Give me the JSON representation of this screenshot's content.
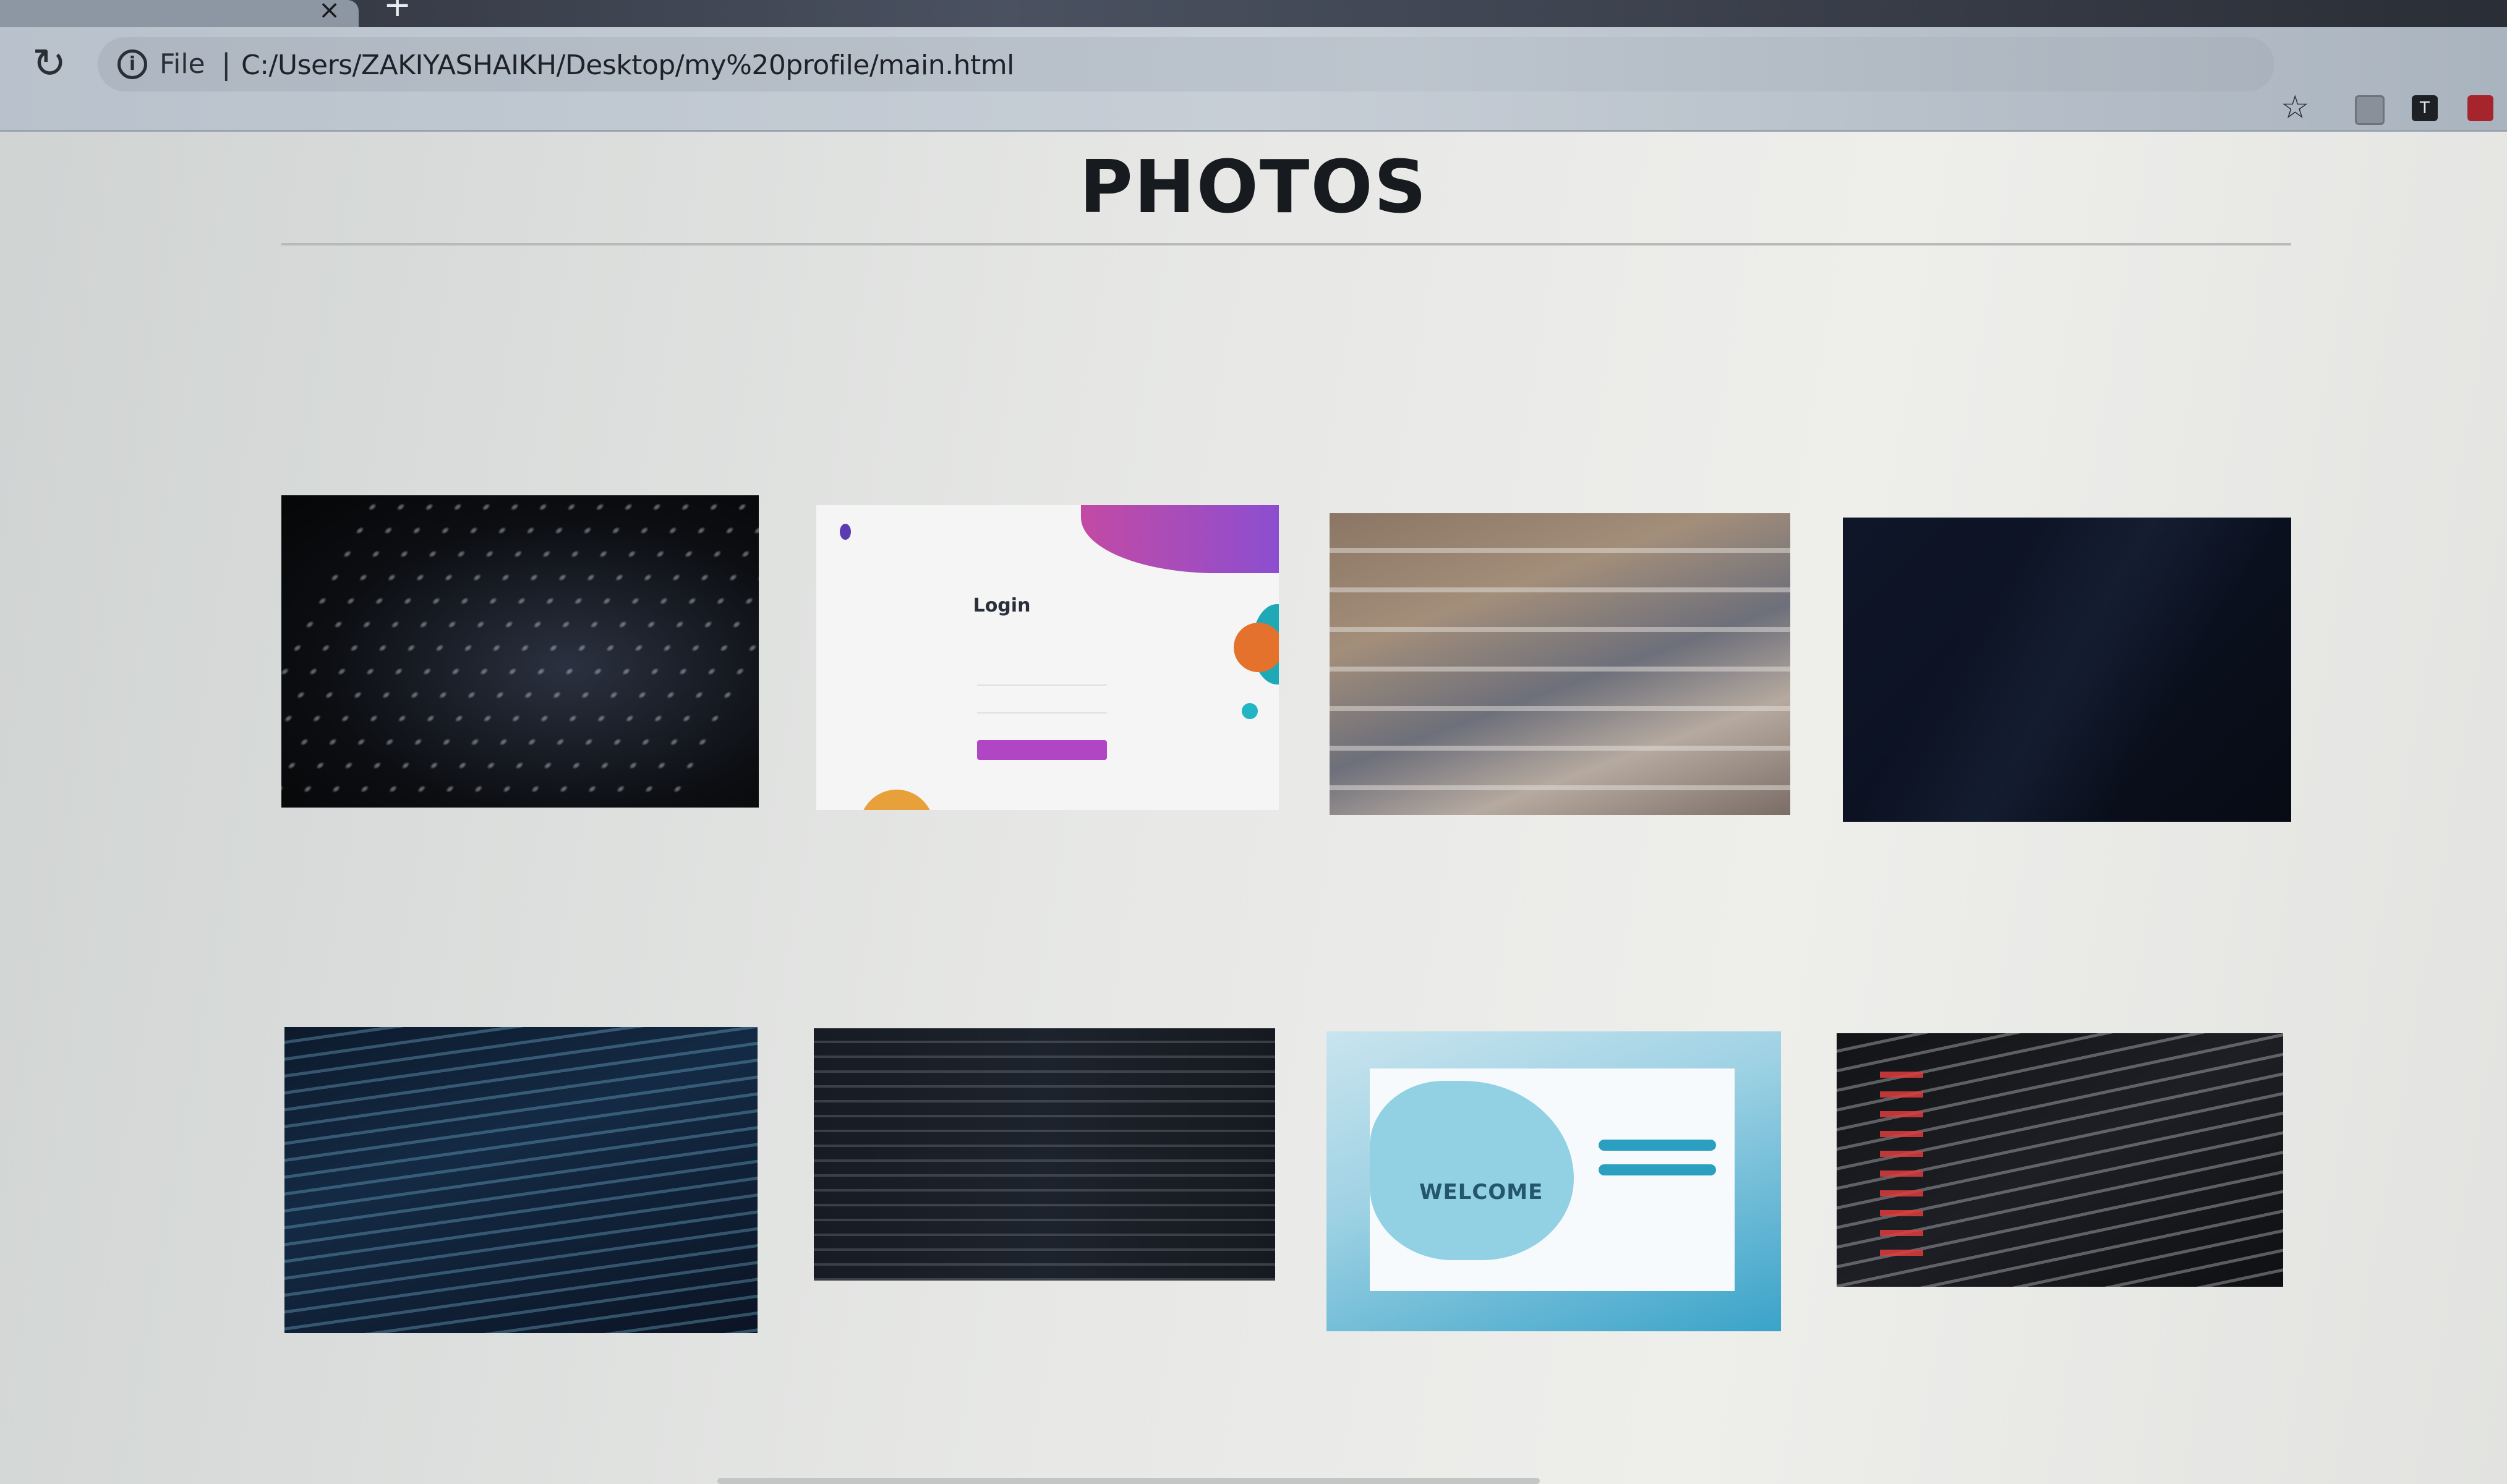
{
  "browser": {
    "scheme_label": "File",
    "separator": "|",
    "url": "C:/Users/ZAKIYASHAIKH/Desktop/my%20profile/main.html",
    "tab_close": "×",
    "new_tab": "+",
    "reload_glyph": "↻",
    "info_glyph": "i",
    "star_glyph": "☆",
    "ext2_glyph": "T"
  },
  "page": {
    "title": "PHOTOS"
  },
  "gallery": {
    "login_heading": "Login",
    "welcome_text": "WELCOME"
  },
  "icons": {
    "reload": "reload-icon",
    "info": "info-icon",
    "bookmark": "star-icon",
    "close_tab": "close-icon",
    "new_tab": "plus-icon"
  },
  "colors": {
    "title": "#171a1f",
    "login_accent": "#b146c4",
    "welcome_accent": "#2a9fc0"
  }
}
